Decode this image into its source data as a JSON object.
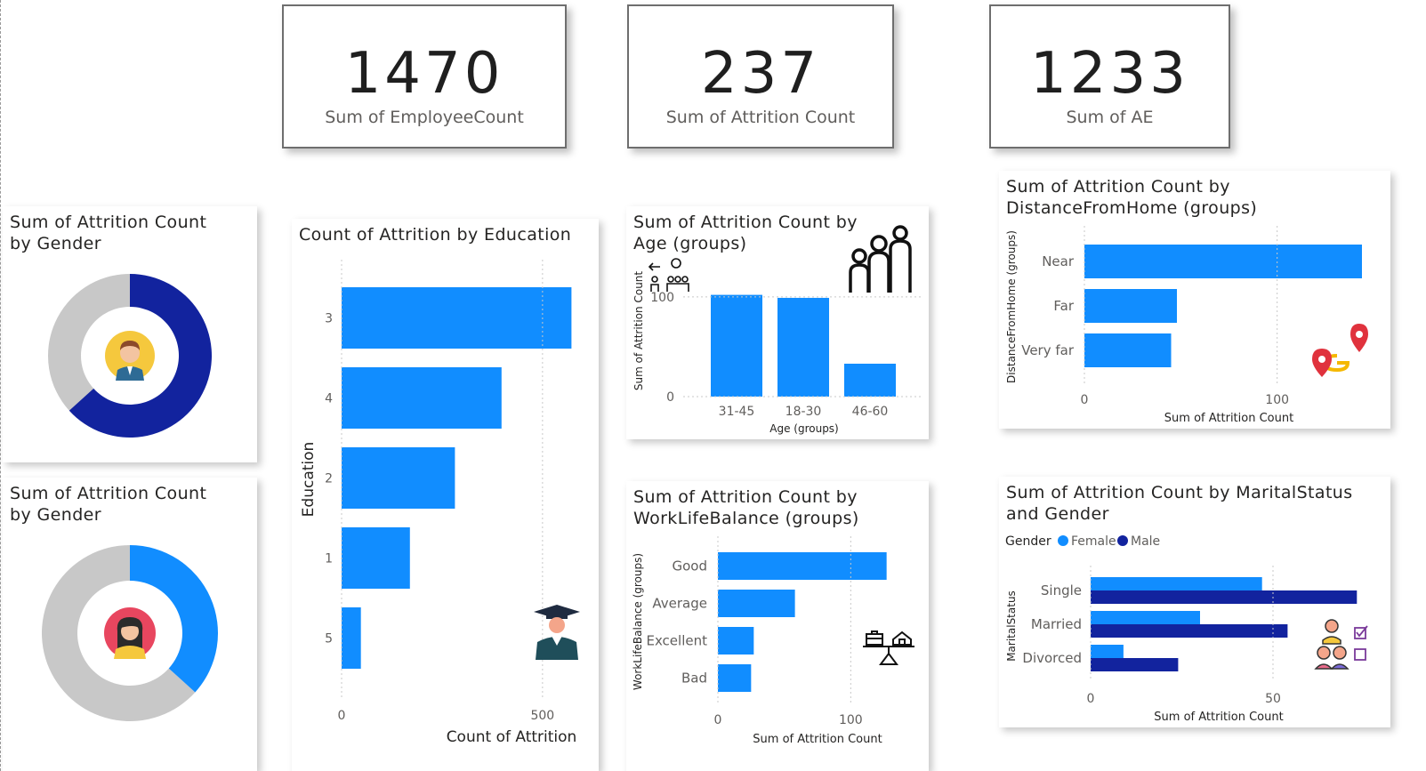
{
  "kpis": [
    {
      "value": "1470",
      "label": "Sum of EmployeeCount"
    },
    {
      "value": "237",
      "label": "Sum of Attrition Count"
    },
    {
      "value": "1233",
      "label": "Sum of AE"
    }
  ],
  "colors": {
    "male": "#12239e",
    "female": "#118dff",
    "neutral": "#c8c8c8",
    "bar": "#118dff"
  },
  "cards": {
    "gender_male": {
      "title": "Sum of Attrition Count by Gender"
    },
    "gender_female": {
      "title": "Sum of Attrition Count by Gender"
    },
    "education": {
      "title": "Count of Attrition by Education"
    },
    "age": {
      "title": "Sum of Attrition Count by Age (groups)"
    },
    "distance": {
      "title": "Sum of Attrition Count by DistanceFromHome (groups)"
    },
    "wlb": {
      "title": "Sum of Attrition Count by WorkLifeBalance (groups)"
    },
    "marital": {
      "title": "Sum of Attrition Count by MaritalStatus and Gender"
    }
  },
  "chart_data": [
    {
      "id": "gender_male",
      "type": "pie",
      "slices": [
        {
          "label": "Male",
          "value": 150
        },
        {
          "label": "Other",
          "value": 87
        }
      ]
    },
    {
      "id": "gender_female",
      "type": "pie",
      "slices": [
        {
          "label": "Female",
          "value": 87
        },
        {
          "label": "Other",
          "value": 150
        }
      ]
    },
    {
      "id": "education",
      "type": "bar",
      "orientation": "horizontal",
      "categories": [
        "3",
        "4",
        "2",
        "1",
        "5"
      ],
      "values": [
        572,
        398,
        282,
        170,
        48
      ],
      "xlabel": "Count of Attrition",
      "ylabel": "Education",
      "xticks": [
        "0",
        "500"
      ],
      "xlim": [
        0,
        580
      ]
    },
    {
      "id": "age",
      "type": "bar",
      "orientation": "vertical",
      "categories": [
        "31-45",
        "18-30",
        "46-60"
      ],
      "values": [
        102,
        99,
        33
      ],
      "xlabel": "Age (groups)",
      "ylabel": "Sum of Attrition Count",
      "yticks": [
        "0",
        "100"
      ],
      "ylim": [
        0,
        115
      ]
    },
    {
      "id": "distance",
      "type": "bar",
      "orientation": "horizontal",
      "categories": [
        "Near",
        "Far",
        "Very far"
      ],
      "values": [
        144,
        48,
        45
      ],
      "xlabel": "Sum of Attrition Count",
      "ylabel": "DistanceFromHome (groups)",
      "xticks": [
        "0",
        "100"
      ],
      "xlim": [
        0,
        150
      ]
    },
    {
      "id": "wlb",
      "type": "bar",
      "orientation": "horizontal",
      "categories": [
        "Good",
        "Average",
        "Excellent",
        "Bad"
      ],
      "values": [
        127,
        58,
        27,
        25
      ],
      "xlabel": "Sum of Attrition Count",
      "ylabel": "WorkLifeBalance (groups)",
      "xticks": [
        "0",
        "100"
      ],
      "xlim": [
        0,
        150
      ]
    },
    {
      "id": "marital",
      "type": "bar",
      "orientation": "horizontal",
      "categories": [
        "Single",
        "Married",
        "Divorced"
      ],
      "series": [
        {
          "name": "Female",
          "values": [
            47,
            30,
            9
          ]
        },
        {
          "name": "Male",
          "values": [
            73,
            54,
            24
          ]
        }
      ],
      "legend_title": "Gender",
      "xlabel": "Sum of Attrition Count",
      "ylabel": "MaritalStatus",
      "xticks": [
        "0",
        "50"
      ],
      "xlim": [
        0,
        80
      ]
    }
  ]
}
